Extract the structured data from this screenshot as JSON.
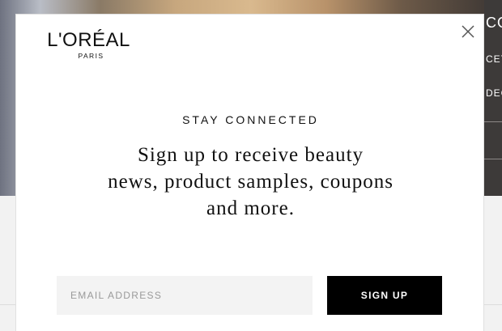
{
  "background": {
    "side_labels": [
      "CO",
      "CET",
      "DEC"
    ]
  },
  "modal": {
    "logo": {
      "brand": "L'ORÉAL",
      "sub": "PARIS"
    },
    "eyebrow": "STAY CONNECTED",
    "headline_lines": [
      "Sign up to receive beauty",
      "news, product samples, coupons",
      "and more."
    ],
    "email_placeholder": "EMAIL ADDRESS",
    "email_value": "",
    "signup_label": "SIGN UP",
    "colors": {
      "button_bg": "#000000",
      "input_bg": "#f3f3f3",
      "text": "#111111"
    }
  }
}
